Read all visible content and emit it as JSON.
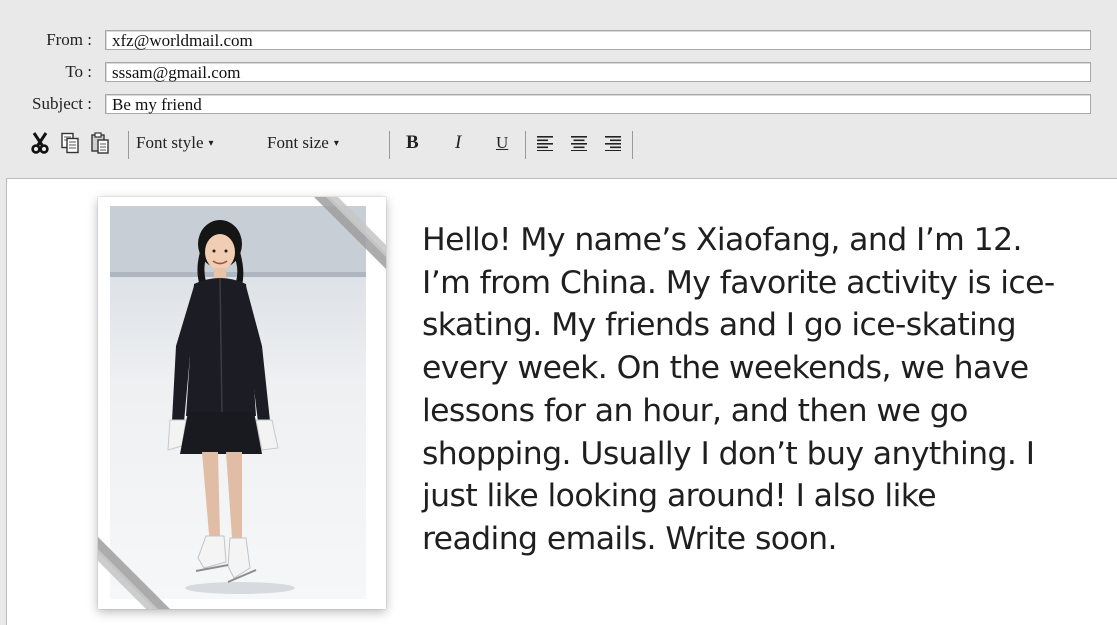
{
  "header": {
    "from": {
      "label": "From :",
      "value": "xfz@worldmail.com"
    },
    "to": {
      "label": "To :",
      "value": "sssam@gmail.com"
    },
    "subject": {
      "label": "Subject :",
      "value": "Be my friend"
    }
  },
  "toolbar": {
    "cut_icon": "scissors-icon",
    "copy_icon": "copy-icon",
    "paste_icon": "paste-icon",
    "font_style": "Font style",
    "font_size": "Font size",
    "bold": "B",
    "italic": "I",
    "underline": "U",
    "align_left_icon": "align-left-icon",
    "align_center_icon": "align-center-icon",
    "align_right_icon": "align-right-icon",
    "caret": "▾"
  },
  "body": {
    "photo": "girl-in-skating-outfit-photo",
    "lines": [
      "Hello! My name’s Xiaofang, and I’m 12.",
      "I’m from China. My favorite activity is ice-",
      "skating. My friends and I go ice-skating",
      "every week. On the weekends, we have",
      "lessons for an hour, and then we go",
      "shopping. Usually I don’t buy anything. I",
      "just like looking around! I also like",
      "reading emails. Write soon."
    ]
  },
  "colors": {
    "window_background": "#e9e9e9",
    "field_background": "#ffffff",
    "text": "#1f1f1f"
  }
}
